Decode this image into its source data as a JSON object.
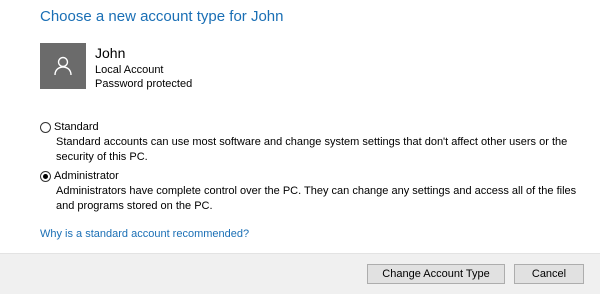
{
  "page": {
    "title": "Choose a new account type for John"
  },
  "user": {
    "name": "John",
    "account_type": "Local Account",
    "password_status": "Password protected"
  },
  "options": {
    "standard": {
      "label": "Standard",
      "description": "Standard accounts can use most software and change system settings that don't affect other users or the security of this PC.",
      "selected": false
    },
    "administrator": {
      "label": "Administrator",
      "description": "Administrators have complete control over the PC. They can change any settings and access all of the files and programs stored on the PC.",
      "selected": true
    }
  },
  "link": {
    "text": "Why is a standard account recommended?"
  },
  "footer": {
    "change_label": "Change Account Type",
    "cancel_label": "Cancel"
  },
  "colors": {
    "accent": "#1a6fb5",
    "avatar_bg": "#6b6b6b",
    "footer_bg": "#f0f0f0"
  },
  "icons": {
    "avatar": "user-icon"
  }
}
